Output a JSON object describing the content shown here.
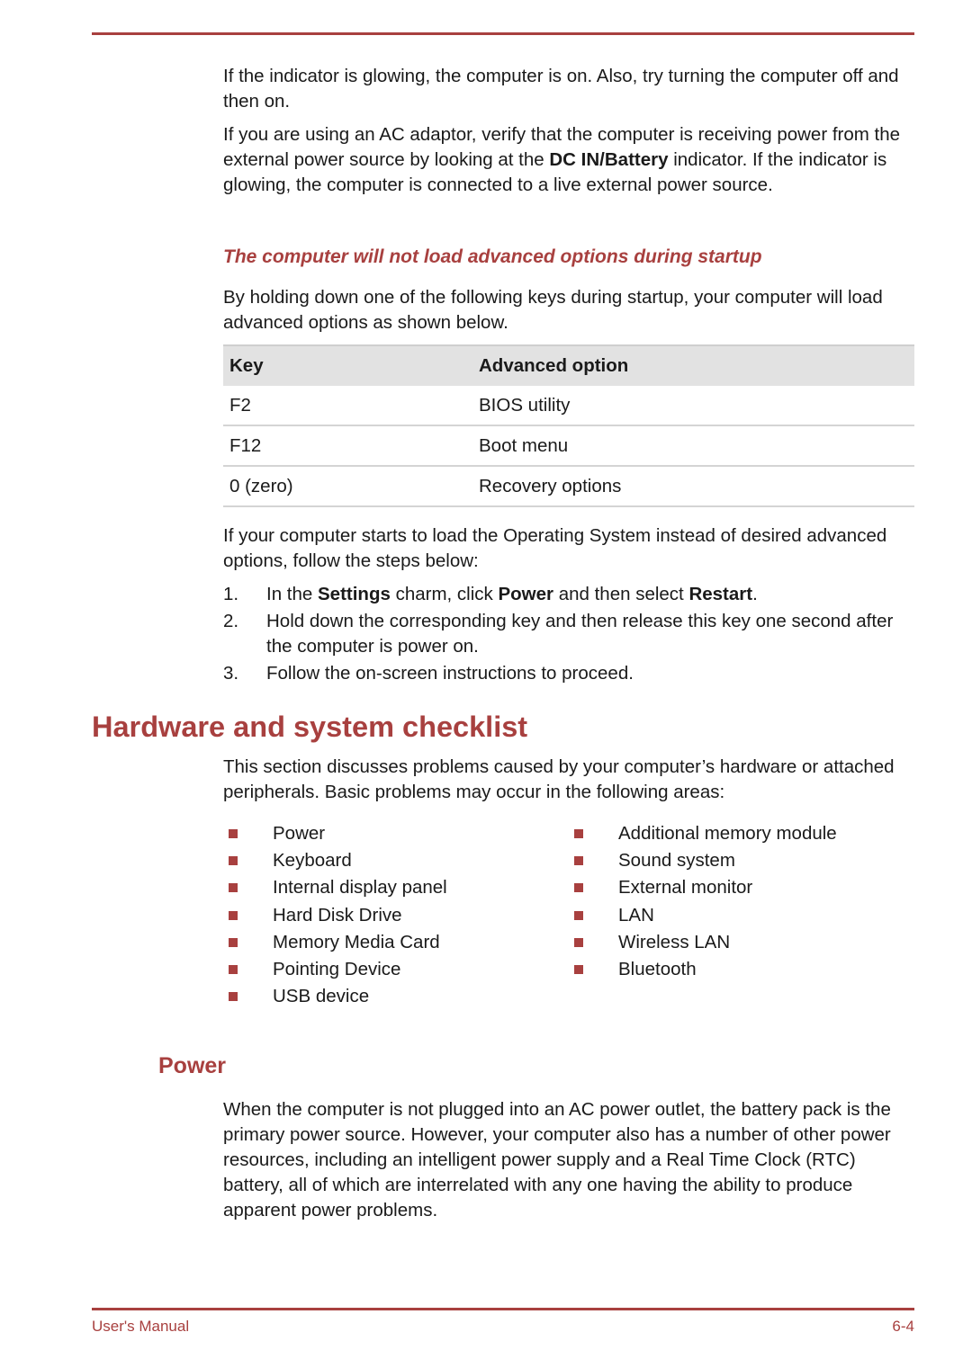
{
  "page": {
    "intro_paragraphs": [
      "If the indicator is glowing, the computer is on. Also, try turning the computer off and then on."
    ],
    "ac_paragraph": {
      "before": "If you are using an AC adaptor, verify that the computer is receiving power from the external power source by looking at the ",
      "bold": "DC IN/Battery",
      "after": " indicator. If the indicator is glowing, the computer is connected to a live external power source."
    },
    "subheading": "The computer will not load advanced options during startup",
    "advanced_intro": "By holding down one of the following keys during startup, your computer will load advanced options as shown below.",
    "table": {
      "headers": [
        "Key",
        "Advanced option"
      ],
      "rows": [
        [
          "F2",
          "BIOS utility"
        ],
        [
          "F12",
          "Boot menu"
        ],
        [
          "0 (zero)",
          "Recovery options"
        ]
      ]
    },
    "os_paragraph": "If your computer starts to load the Operating System instead of desired advanced options, follow the steps below:",
    "steps": [
      {
        "num": "1.",
        "parts": [
          "In the ",
          "Settings",
          " charm, click ",
          "Power",
          " and then select ",
          "Restart",
          "."
        ]
      },
      {
        "num": "2.",
        "text": "Hold down the corresponding key and then release this key one second after the computer is power on."
      },
      {
        "num": "3.",
        "text": "Follow the on-screen instructions to proceed."
      }
    ],
    "section_title": "Hardware and system checklist",
    "section_intro": "This section discusses problems caused by your computer’s hardware or attached peripherals. Basic problems may occur in the following areas:",
    "checklist_left": [
      "Power",
      "Keyboard",
      "Internal display panel",
      "Hard Disk Drive",
      "Memory Media Card",
      "Pointing Device",
      "USB device"
    ],
    "checklist_right": [
      "Additional memory module",
      "Sound system",
      "External monitor",
      "LAN",
      "Wireless LAN",
      "Bluetooth"
    ],
    "power_heading": "Power",
    "power_paragraph": "When the computer is not plugged into an AC power outlet, the battery pack is the primary power source. However, your computer also has a number of other power resources, including an intelligent power supply and a Real Time Clock (RTC) battery, all of which are interrelated with any one having the ability to produce apparent power problems."
  },
  "footer": {
    "left": "User's Manual",
    "right": "6-4"
  },
  "colors": {
    "accent": "#a8403f",
    "table_header_bg": "#e2e2e2"
  }
}
